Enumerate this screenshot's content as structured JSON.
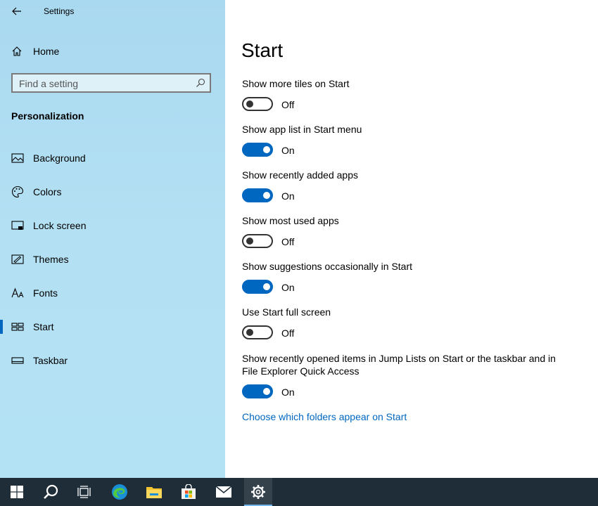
{
  "window": {
    "title": "Settings"
  },
  "sidebar": {
    "home_label": "Home",
    "search_placeholder": "Find a setting",
    "section_title": "Personalization",
    "items": [
      {
        "label": "Background",
        "icon": "background-icon"
      },
      {
        "label": "Colors",
        "icon": "palette-icon"
      },
      {
        "label": "Lock screen",
        "icon": "lock-screen-icon"
      },
      {
        "label": "Themes",
        "icon": "themes-icon"
      },
      {
        "label": "Fonts",
        "icon": "fonts-icon"
      },
      {
        "label": "Start",
        "icon": "start-layout-icon",
        "selected": true
      },
      {
        "label": "Taskbar",
        "icon": "taskbar-icon"
      }
    ]
  },
  "main": {
    "title": "Start",
    "settings": [
      {
        "label": "Show more tiles on Start",
        "on": false,
        "state": "Off"
      },
      {
        "label": "Show app list in Start menu",
        "on": true,
        "state": "On"
      },
      {
        "label": "Show recently added apps",
        "on": true,
        "state": "On"
      },
      {
        "label": "Show most used apps",
        "on": false,
        "state": "Off"
      },
      {
        "label": "Show suggestions occasionally in Start",
        "on": true,
        "state": "On"
      },
      {
        "label": "Use Start full screen",
        "on": false,
        "state": "Off"
      },
      {
        "label": "Show recently opened items in Jump Lists on Start or the taskbar and in File Explorer Quick Access",
        "on": true,
        "state": "On"
      }
    ],
    "link": "Choose which folders appear on Start"
  },
  "taskbar": {
    "icons": [
      "windows-start-icon",
      "search-icon",
      "task-view-icon",
      "edge-icon",
      "file-explorer-icon",
      "store-icon",
      "mail-icon",
      "settings-gear-icon"
    ],
    "active": "settings-gear-icon"
  },
  "colors": {
    "accent": "#0067c0",
    "taskbar": "#1f2d38",
    "sidebar": "#b3e2f4"
  }
}
